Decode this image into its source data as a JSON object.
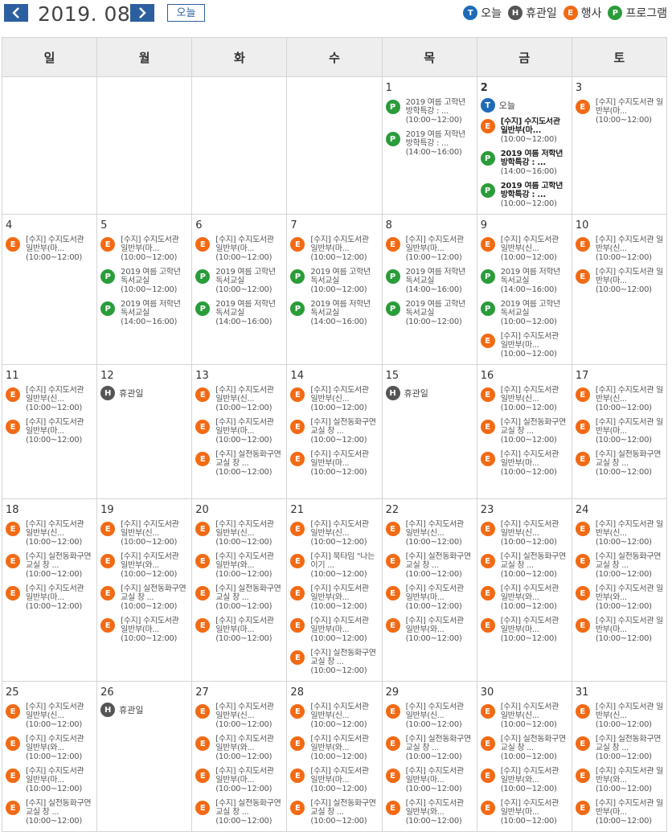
{
  "header": {
    "month_label": "2019. 08",
    "today_button": "오늘",
    "legend": [
      {
        "letter": "T",
        "label": "오늘",
        "color": "#1f6bb8"
      },
      {
        "letter": "H",
        "label": "휴관일",
        "color": "#555555"
      },
      {
        "letter": "E",
        "label": "행사",
        "color": "#f26a14"
      },
      {
        "letter": "P",
        "label": "프로그램",
        "color": "#2a9c3a"
      }
    ]
  },
  "weekdays": [
    "일",
    "월",
    "화",
    "수",
    "목",
    "금",
    "토"
  ],
  "weeks": [
    [
      {
        "day": "",
        "events": []
      },
      {
        "day": "",
        "events": []
      },
      {
        "day": "",
        "events": []
      },
      {
        "day": "",
        "events": []
      },
      {
        "day": "1",
        "events": [
          {
            "type": "P",
            "title": "2019 여름 고학년 방학특강 : ...",
            "time": "(10:00~12:00)"
          },
          {
            "type": "P",
            "title": "2019 여름 저학년 방학특강 : ...",
            "time": "(14:00~16:00)"
          }
        ]
      },
      {
        "day": "2",
        "bold": true,
        "today_label": "오늘",
        "events": [
          {
            "type": "E",
            "title": "[수지] 수지도서관 일반부(마...",
            "time": "(10:00~12:00)",
            "bold": true
          },
          {
            "type": "P",
            "title": "2019 여름 저학년 방학특강 : ...",
            "time": "(14:00~16:00)",
            "bold": true
          },
          {
            "type": "P",
            "title": "2019 여름 고학년 방학특강 : ...",
            "time": "(10:00~12:00)",
            "bold": true
          }
        ]
      },
      {
        "day": "3",
        "events": [
          {
            "type": "E",
            "title": "[수지] 수지도서관 일반부(마...",
            "time": "(10:00~12:00)"
          }
        ]
      }
    ],
    [
      {
        "day": "4",
        "events": [
          {
            "type": "E",
            "title": "[수지] 수지도서관 일반부(마...",
            "time": "(10:00~12:00)"
          }
        ]
      },
      {
        "day": "5",
        "events": [
          {
            "type": "E",
            "title": "[수지] 수지도서관 일반부(마...",
            "time": "(10:00~12:00)"
          },
          {
            "type": "P",
            "title": "2019 여름 고학년 독서교실",
            "time": "(10:00~12:00)"
          },
          {
            "type": "P",
            "title": "2019 여름 저학년 독서교실",
            "time": "(14:00~16:00)"
          }
        ]
      },
      {
        "day": "6",
        "events": [
          {
            "type": "E",
            "title": "[수지] 수지도서관 일반부(마...",
            "time": "(10:00~12:00)"
          },
          {
            "type": "P",
            "title": "2019 여름 고학년 독서교실",
            "time": "(10:00~12:00)"
          },
          {
            "type": "P",
            "title": "2019 여름 저학년 독서교실",
            "time": "(14:00~16:00)"
          }
        ]
      },
      {
        "day": "7",
        "events": [
          {
            "type": "E",
            "title": "[수지] 수지도서관 일반부(마...",
            "time": "(10:00~12:00)"
          },
          {
            "type": "P",
            "title": "2019 여름 고학년 독서교실",
            "time": "(10:00~12:00)"
          },
          {
            "type": "P",
            "title": "2019 여름 저학년 독서교실",
            "time": "(14:00~16:00)"
          }
        ]
      },
      {
        "day": "8",
        "events": [
          {
            "type": "E",
            "title": "[수지] 수지도서관 일반부(마...",
            "time": "(10:00~12:00)"
          },
          {
            "type": "P",
            "title": "2019 여름 저학년 독서교실",
            "time": "(14:00~16:00)"
          },
          {
            "type": "P",
            "title": "2019 여름 고학년 독서교실",
            "time": "(10:00~12:00)"
          }
        ]
      },
      {
        "day": "9",
        "events": [
          {
            "type": "E",
            "title": "[수지] 수지도서관 일반부(신...",
            "time": "(10:00~12:00)"
          },
          {
            "type": "P",
            "title": "2019 여름 저학년 독서교실",
            "time": "(14:00~16:00)"
          },
          {
            "type": "P",
            "title": "2019 여름 고학년 독서교실",
            "time": "(10:00~12:00)"
          },
          {
            "type": "E",
            "title": "[수지] 수지도서관 일반부(마...",
            "time": "(10:00~12:00)"
          }
        ]
      },
      {
        "day": "10",
        "events": [
          {
            "type": "E",
            "title": "[수지] 수지도서관 일반부(신...",
            "time": "(10:00~12:00)"
          },
          {
            "type": "E",
            "title": "[수지] 수지도서관 일반부(마...",
            "time": "(10:00~12:00)"
          }
        ]
      }
    ],
    [
      {
        "day": "11",
        "events": [
          {
            "type": "E",
            "title": "[수지] 수지도서관 일반부(신...",
            "time": "(10:00~12:00)"
          },
          {
            "type": "E",
            "title": "[수지] 수지도서관 일반부(마...",
            "time": "(10:00~12:00)"
          }
        ]
      },
      {
        "day": "12",
        "closed_label": "휴관일",
        "events": []
      },
      {
        "day": "13",
        "events": [
          {
            "type": "E",
            "title": "[수지] 수지도서관 일반부(신...",
            "time": "(10:00~12:00)"
          },
          {
            "type": "E",
            "title": "[수지] 수지도서관 일반부(마...",
            "time": "(10:00~12:00)"
          },
          {
            "type": "E",
            "title": "[수지] 실전동화구연교실 창 ...",
            "time": "(10:00~12:00)"
          }
        ]
      },
      {
        "day": "14",
        "events": [
          {
            "type": "E",
            "title": "[수지] 수지도서관 일반부(신...",
            "time": "(10:00~12:00)"
          },
          {
            "type": "E",
            "title": "[수지] 실전동화구연교실 창 ...",
            "time": "(10:00~12:00)"
          },
          {
            "type": "E",
            "title": "[수지] 수지도서관 일반부(마...",
            "time": "(10:00~12:00)"
          }
        ]
      },
      {
        "day": "15",
        "closed_label": "휴관일",
        "events": []
      },
      {
        "day": "16",
        "events": [
          {
            "type": "E",
            "title": "[수지] 수지도서관 일반부(신...",
            "time": "(10:00~12:00)"
          },
          {
            "type": "E",
            "title": "[수지] 실전동화구연교실 창 ...",
            "time": "(10:00~12:00)"
          },
          {
            "type": "E",
            "title": "[수지] 수지도서관 일반부(마...",
            "time": "(10:00~12:00)"
          }
        ]
      },
      {
        "day": "17",
        "events": [
          {
            "type": "E",
            "title": "[수지] 수지도서관 일반부(신...",
            "time": "(10:00~12:00)"
          },
          {
            "type": "E",
            "title": "[수지] 수지도서관 일반부(마...",
            "time": "(10:00~12:00)"
          },
          {
            "type": "E",
            "title": "[수지] 실전동화구연교실 창 ...",
            "time": "(10:00~12:00)"
          }
        ]
      }
    ],
    [
      {
        "day": "18",
        "events": [
          {
            "type": "E",
            "title": "[수지] 수지도서관 일반부(신...",
            "time": "(10:00~12:00)"
          },
          {
            "type": "E",
            "title": "[수지] 실전동화구연교실 창 ...",
            "time": "(10:00~12:00)"
          },
          {
            "type": "E",
            "title": "[수지] 수지도서관 일반부(마...",
            "time": "(10:00~12:00)"
          }
        ]
      },
      {
        "day": "19",
        "events": [
          {
            "type": "E",
            "title": "[수지] 수지도서관 일반부(신...",
            "time": "(10:00~12:00)"
          },
          {
            "type": "E",
            "title": "[수지] 수지도서관 일반부(와...",
            "time": "(10:00~12:00)"
          },
          {
            "type": "E",
            "title": "[수지] 실전동화구연교실 창 ...",
            "time": "(10:00~12:00)"
          },
          {
            "type": "E",
            "title": "[수지] 수지도서관 일반부(마...",
            "time": "(10:00~12:00)"
          }
        ]
      },
      {
        "day": "20",
        "events": [
          {
            "type": "E",
            "title": "[수지] 수지도서관 일반부(신...",
            "time": "(10:00~12:00)"
          },
          {
            "type": "E",
            "title": "[수지] 수지도서관 일반부(와...",
            "time": "(10:00~12:00)"
          },
          {
            "type": "E",
            "title": "[수지] 실전동화구연교실 창 ...",
            "time": "(10:00~12:00)"
          },
          {
            "type": "E",
            "title": "[수지] 수지도서관 일반부(마...",
            "time": "(10:00~12:00)"
          }
        ]
      },
      {
        "day": "21",
        "events": [
          {
            "type": "E",
            "title": "[수지] 수지도서관 일반부(신...",
            "time": "(10:00~12:00)"
          },
          {
            "type": "E",
            "title": "[수지] 북타임 \"나는 이기 ...",
            "time": "(10:00~12:00)"
          },
          {
            "type": "E",
            "title": "[수지] 수지도서관 일반부(와...",
            "time": "(10:00~12:00)"
          },
          {
            "type": "E",
            "title": "[수지] 수지도서관 일반부(마...",
            "time": "(10:00~12:00)"
          },
          {
            "type": "E",
            "title": "[수지] 실전동화구연교실 창 ...",
            "time": "(10:00~12:00)"
          }
        ]
      },
      {
        "day": "22",
        "events": [
          {
            "type": "E",
            "title": "[수지] 수지도서관 일반부(신...",
            "time": "(10:00~12:00)"
          },
          {
            "type": "E",
            "title": "[수지] 실전동화구연교실 창 ...",
            "time": "(10:00~12:00)"
          },
          {
            "type": "E",
            "title": "[수지] 수지도서관 일반부(마...",
            "time": "(10:00~12:00)"
          },
          {
            "type": "E",
            "title": "[수지] 수지도서관 일반부(와...",
            "time": "(10:00~12:00)"
          }
        ]
      },
      {
        "day": "23",
        "events": [
          {
            "type": "E",
            "title": "[수지] 수지도서관 일반부(신...",
            "time": "(10:00~12:00)"
          },
          {
            "type": "E",
            "title": "[수지] 실전동화구연교실 창 ...",
            "time": "(10:00~12:00)"
          },
          {
            "type": "E",
            "title": "[수지] 수지도서관 일반부(와...",
            "time": "(10:00~12:00)"
          },
          {
            "type": "E",
            "title": "[수지] 수지도서관 일반부(마...",
            "time": "(10:00~12:00)"
          }
        ]
      },
      {
        "day": "24",
        "events": [
          {
            "type": "E",
            "title": "[수지] 수지도서관 일반부(신...",
            "time": "(10:00~12:00)"
          },
          {
            "type": "E",
            "title": "[수지] 실전동화구연교실 창 ...",
            "time": "(10:00~12:00)"
          },
          {
            "type": "E",
            "title": "[수지] 수지도서관 일반부(와...",
            "time": "(10:00~12:00)"
          },
          {
            "type": "E",
            "title": "[수지] 수지도서관 일반부(마...",
            "time": "(10:00~12:00)"
          }
        ]
      }
    ],
    [
      {
        "day": "25",
        "events": [
          {
            "type": "E",
            "title": "[수지] 수지도서관 일반부(신...",
            "time": "(10:00~12:00)"
          },
          {
            "type": "E",
            "title": "[수지] 수지도서관 일반부(와...",
            "time": "(10:00~12:00)"
          },
          {
            "type": "E",
            "title": "[수지] 수지도서관 일반부(마...",
            "time": "(10:00~12:00)"
          },
          {
            "type": "E",
            "title": "[수지] 실전동화구연교실 창 ...",
            "time": "(10:00~12:00)"
          }
        ]
      },
      {
        "day": "26",
        "closed_label": "휴관일",
        "events": []
      },
      {
        "day": "27",
        "events": [
          {
            "type": "E",
            "title": "[수지] 수지도서관 일반부(신...",
            "time": "(10:00~12:00)"
          },
          {
            "type": "E",
            "title": "[수지] 수지도서관 일반부(와...",
            "time": "(10:00~12:00)"
          },
          {
            "type": "E",
            "title": "[수지] 수지도서관 일반부(마...",
            "time": "(10:00~12:00)"
          },
          {
            "type": "E",
            "title": "[수지] 실전동화구연교실 창 ...",
            "time": "(10:00~12:00)"
          }
        ]
      },
      {
        "day": "28",
        "events": [
          {
            "type": "E",
            "title": "[수지] 수지도서관 일반부(신...",
            "time": "(10:00~12:00)"
          },
          {
            "type": "E",
            "title": "[수지] 수지도서관 일반부(와...",
            "time": "(10:00~12:00)"
          },
          {
            "type": "E",
            "title": "[수지] 수지도서관 일반부(마...",
            "time": "(10:00~12:00)"
          },
          {
            "type": "E",
            "title": "[수지] 실전동화구연교실 창 ...",
            "time": "(10:00~12:00)"
          }
        ]
      },
      {
        "day": "29",
        "events": [
          {
            "type": "E",
            "title": "[수지] 수지도서관 일반부(신...",
            "time": "(10:00~12:00)"
          },
          {
            "type": "E",
            "title": "[수지] 실전동화구연교실 창 ...",
            "time": "(10:00~12:00)"
          },
          {
            "type": "E",
            "title": "[수지] 수지도서관 일반부(마...",
            "time": "(10:00~12:00)"
          },
          {
            "type": "E",
            "title": "[수지] 수지도서관 일반부(와...",
            "time": "(10:00~12:00)"
          }
        ]
      },
      {
        "day": "30",
        "events": [
          {
            "type": "E",
            "title": "[수지] 수지도서관 일반부(신...",
            "time": "(10:00~12:00)"
          },
          {
            "type": "E",
            "title": "[수지] 실전동화구연교실 창 ...",
            "time": "(10:00~12:00)"
          },
          {
            "type": "E",
            "title": "[수지] 수지도서관 일반부(와...",
            "time": "(10:00~12:00)"
          },
          {
            "type": "E",
            "title": "[수지] 수지도서관 일반부(마...",
            "time": "(10:00~12:00)"
          }
        ]
      },
      {
        "day": "31",
        "events": [
          {
            "type": "E",
            "title": "[수지] 수지도서관 일반부(신...",
            "time": "(10:00~12:00)"
          },
          {
            "type": "E",
            "title": "[수지] 실전동화구연교실 창 ...",
            "time": "(10:00~12:00)"
          },
          {
            "type": "E",
            "title": "[수지] 수지도서관 일반부(와...",
            "time": "(10:00~12:00)"
          },
          {
            "type": "E",
            "title": "[수지] 수지도서관 일반부(마...",
            "time": "(10:00~12:00)"
          }
        ]
      }
    ]
  ]
}
